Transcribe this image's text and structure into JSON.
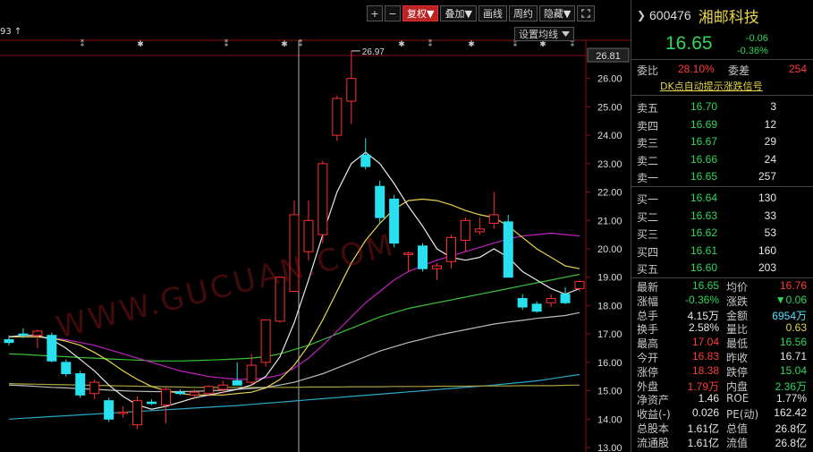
{
  "toolbar": {
    "zoom_in": "+",
    "zoom_out": "−",
    "fuquan": "复权▼",
    "diejia": "叠加▼",
    "huaxian": "画线",
    "zhouqi": "周约",
    "yincang": "隐藏▼"
  },
  "chart": {
    "top_label": "93 ↑",
    "ma_setting": "设置均线",
    "max_label": "26.97",
    "watermark": "WWW.GUCUAN.COM"
  },
  "chart_data": {
    "type": "candlestick",
    "ylim": [
      13.0,
      26.81
    ],
    "y_ticks": [
      13.0,
      14.0,
      15.0,
      16.0,
      17.0,
      18.0,
      19.0,
      20.0,
      21.0,
      22.0,
      23.0,
      24.0,
      25.0,
      26.0
    ],
    "top_value_label": "26.81",
    "candles": [
      {
        "o": 16.8,
        "h": 16.95,
        "l": 16.6,
        "c": 16.7
      },
      {
        "o": 17.0,
        "h": 17.2,
        "l": 16.85,
        "c": 16.95
      },
      {
        "o": 16.95,
        "h": 17.15,
        "l": 16.5,
        "c": 17.1
      },
      {
        "o": 16.95,
        "h": 17.05,
        "l": 16.0,
        "c": 16.05
      },
      {
        "o": 16.0,
        "h": 16.1,
        "l": 15.5,
        "c": 15.6
      },
      {
        "o": 15.6,
        "h": 15.7,
        "l": 14.75,
        "c": 14.85
      },
      {
        "o": 14.9,
        "h": 15.4,
        "l": 14.7,
        "c": 15.3
      },
      {
        "o": 14.65,
        "h": 14.75,
        "l": 13.9,
        "c": 14.0
      },
      {
        "o": 14.2,
        "h": 14.45,
        "l": 14.05,
        "c": 14.25
      },
      {
        "o": 13.8,
        "h": 14.8,
        "l": 13.65,
        "c": 14.65
      },
      {
        "o": 14.6,
        "h": 14.7,
        "l": 14.5,
        "c": 14.55
      },
      {
        "o": 14.5,
        "h": 15.1,
        "l": 13.85,
        "c": 15.05
      },
      {
        "o": 14.95,
        "h": 15.05,
        "l": 14.85,
        "c": 14.9
      },
      {
        "o": 14.85,
        "h": 15.05,
        "l": 14.7,
        "c": 14.95
      },
      {
        "o": 14.9,
        "h": 15.2,
        "l": 14.8,
        "c": 15.15
      },
      {
        "o": 15.05,
        "h": 15.35,
        "l": 14.9,
        "c": 15.2
      },
      {
        "o": 15.35,
        "h": 16.0,
        "l": 15.2,
        "c": 15.2
      },
      {
        "o": 15.3,
        "h": 16.3,
        "l": 15.2,
        "c": 15.9
      },
      {
        "o": 16.0,
        "h": 16.9,
        "l": 15.85,
        "c": 17.5
      },
      {
        "o": 17.45,
        "h": 19.0,
        "l": 17.4,
        "c": 19.0
      },
      {
        "o": 18.5,
        "h": 21.7,
        "l": 18.5,
        "c": 21.2
      },
      {
        "o": 19.9,
        "h": 21.7,
        "l": 19.6,
        "c": 21.0
      },
      {
        "o": 20.5,
        "h": 23.1,
        "l": 20.2,
        "c": 23.0
      },
      {
        "o": 24.0,
        "h": 25.4,
        "l": 23.8,
        "c": 25.3
      },
      {
        "o": 25.2,
        "h": 26.97,
        "l": 24.4,
        "c": 26.0
      },
      {
        "o": 23.3,
        "h": 23.9,
        "l": 22.8,
        "c": 22.9
      },
      {
        "o": 22.2,
        "h": 22.4,
        "l": 20.9,
        "c": 21.1
      },
      {
        "o": 21.75,
        "h": 21.9,
        "l": 20.05,
        "c": 20.2
      },
      {
        "o": 19.8,
        "h": 19.9,
        "l": 19.2,
        "c": 19.85
      },
      {
        "o": 20.1,
        "h": 20.2,
        "l": 19.2,
        "c": 19.3
      },
      {
        "o": 19.3,
        "h": 19.5,
        "l": 18.9,
        "c": 19.4
      },
      {
        "o": 19.55,
        "h": 20.5,
        "l": 19.3,
        "c": 20.4
      },
      {
        "o": 20.3,
        "h": 21.1,
        "l": 19.9,
        "c": 21.0
      },
      {
        "o": 20.6,
        "h": 21.1,
        "l": 20.5,
        "c": 20.7
      },
      {
        "o": 20.9,
        "h": 22.0,
        "l": 20.7,
        "c": 21.2
      },
      {
        "o": 20.95,
        "h": 21.2,
        "l": 19.0,
        "c": 19.0
      },
      {
        "o": 18.25,
        "h": 18.4,
        "l": 17.85,
        "c": 17.95
      },
      {
        "o": 18.05,
        "h": 18.15,
        "l": 17.75,
        "c": 17.8
      },
      {
        "o": 18.1,
        "h": 18.4,
        "l": 17.95,
        "c": 18.25
      },
      {
        "o": 18.4,
        "h": 18.65,
        "l": 18.05,
        "c": 18.1
      },
      {
        "o": 18.6,
        "h": 18.9,
        "l": 18.5,
        "c": 18.85
      }
    ],
    "ma_white": [
      16.9,
      16.95,
      16.95,
      16.8,
      16.5,
      16.1,
      15.7,
      15.2,
      14.8,
      14.5,
      14.35,
      14.45,
      14.6,
      14.75,
      14.85,
      14.95,
      15.05,
      15.2,
      15.5,
      16.2,
      17.4,
      18.9,
      20.5,
      22.0,
      23.0,
      23.4,
      23.0,
      22.3,
      21.5,
      20.8,
      20.0,
      19.7,
      19.6,
      19.7,
      20.0,
      19.7,
      19.2,
      18.9,
      18.6,
      18.4,
      18.6
    ],
    "ma_yellow": [
      16.9,
      16.9,
      16.9,
      16.85,
      16.75,
      16.6,
      16.35,
      16.05,
      15.7,
      15.4,
      15.15,
      15.0,
      14.9,
      14.85,
      14.85,
      14.85,
      14.9,
      14.95,
      15.1,
      15.4,
      15.9,
      16.6,
      17.5,
      18.5,
      19.5,
      20.3,
      20.9,
      21.4,
      21.7,
      21.75,
      21.7,
      21.55,
      21.35,
      21.2,
      21.1,
      20.8,
      20.4,
      20.0,
      19.7,
      19.4,
      19.3
    ],
    "ma_purple": [
      16.9,
      16.9,
      16.9,
      16.85,
      16.8,
      16.7,
      16.6,
      16.45,
      16.3,
      16.15,
      16.0,
      15.85,
      15.7,
      15.6,
      15.5,
      15.45,
      15.4,
      15.4,
      15.45,
      15.55,
      15.8,
      16.15,
      16.6,
      17.1,
      17.6,
      18.1,
      18.5,
      18.9,
      19.2,
      19.4,
      19.6,
      19.75,
      19.9,
      20.05,
      20.2,
      20.35,
      20.45,
      20.5,
      20.55,
      20.5,
      20.45
    ],
    "ma_green": [
      16.3,
      16.28,
      16.25,
      16.22,
      16.2,
      16.17,
      16.15,
      16.12,
      16.1,
      16.08,
      16.05,
      16.05,
      16.05,
      16.06,
      16.08,
      16.1,
      16.12,
      16.15,
      16.2,
      16.3,
      16.45,
      16.6,
      16.8,
      17.0,
      17.2,
      17.4,
      17.6,
      17.75,
      17.9,
      18.0,
      18.1,
      18.2,
      18.3,
      18.4,
      18.5,
      18.6,
      18.7,
      18.8,
      18.9,
      19.0,
      19.1
    ],
    "ma_gray": [
      15.2,
      15.18,
      15.15,
      15.12,
      15.1,
      15.07,
      15.05,
      15.02,
      15.0,
      14.98,
      14.97,
      14.97,
      14.97,
      14.98,
      15.0,
      15.02,
      15.05,
      15.08,
      15.12,
      15.2,
      15.3,
      15.45,
      15.6,
      15.8,
      16.0,
      16.2,
      16.4,
      16.55,
      16.7,
      16.82,
      16.95,
      17.05,
      17.15,
      17.25,
      17.35,
      17.42,
      17.48,
      17.55,
      17.6,
      17.65,
      17.75
    ],
    "ma_olive": [
      15.25,
      15.24,
      15.23,
      15.22,
      15.21,
      15.2,
      15.19,
      15.18,
      15.17,
      15.16,
      15.15,
      15.14,
      15.13,
      15.12,
      15.12,
      15.12,
      15.12,
      15.12,
      15.12,
      15.12,
      15.12,
      15.13,
      15.13,
      15.13,
      15.14,
      15.14,
      15.14,
      15.15,
      15.15,
      15.15,
      15.16,
      15.16,
      15.16,
      15.17,
      15.17,
      15.17,
      15.18,
      15.18,
      15.18,
      15.19,
      15.2
    ],
    "ma_cyan": [
      14.0,
      14.03,
      14.06,
      14.09,
      14.12,
      14.15,
      14.18,
      14.21,
      14.24,
      14.27,
      14.3,
      14.33,
      14.36,
      14.39,
      14.42,
      14.45,
      14.48,
      14.52,
      14.56,
      14.6,
      14.64,
      14.68,
      14.72,
      14.76,
      14.8,
      14.84,
      14.88,
      14.92,
      14.96,
      15.0,
      15.04,
      15.08,
      15.12,
      15.16,
      15.2,
      15.25,
      15.3,
      15.35,
      15.42,
      15.5,
      15.57
    ],
    "colors": {
      "up": "#ff3030",
      "down": "#28e0f0",
      "white": "#e8e8e8",
      "yellow": "#e6d54a",
      "purple": "#c020c0",
      "green": "#38c038",
      "gray": "#bdbdbd",
      "olive": "#a8a040",
      "cyan": "#2aa8c8"
    }
  },
  "panel": {
    "code": "600476",
    "name": "湘邮科技",
    "price": "16.65",
    "change": "-0.06",
    "change_pct": "-0.36%",
    "weibi_label": "委比",
    "weibi_value": "28.10%",
    "weicha_label": "委差",
    "weicha_value": "254",
    "signal_link": "DK点自动提示涨跌信号",
    "sell": [
      {
        "label": "卖五",
        "price": "16.70",
        "vol": "3"
      },
      {
        "label": "卖四",
        "price": "16.69",
        "vol": "12"
      },
      {
        "label": "卖三",
        "price": "16.67",
        "vol": "29"
      },
      {
        "label": "卖二",
        "price": "16.66",
        "vol": "24"
      },
      {
        "label": "卖一",
        "price": "16.65",
        "vol": "257"
      }
    ],
    "buy": [
      {
        "label": "买一",
        "price": "16.64",
        "vol": "130"
      },
      {
        "label": "买二",
        "price": "16.63",
        "vol": "33"
      },
      {
        "label": "买三",
        "price": "16.62",
        "vol": "53"
      },
      {
        "label": "买四",
        "price": "16.61",
        "vol": "160"
      },
      {
        "label": "买五",
        "price": "16.60",
        "vol": "203"
      }
    ],
    "stats": [
      {
        "l1": "最新",
        "v1": "16.65",
        "c1": "grn",
        "l2": "均价",
        "v2": "16.76",
        "c2": "red"
      },
      {
        "l1": "涨幅",
        "v1": "-0.36%",
        "c1": "grn",
        "l2": "涨跌",
        "v2": "▼0.06",
        "c2": "grn"
      },
      {
        "l1": "总手",
        "v1": "4.15万",
        "c1": "wht",
        "l2": "金额",
        "v2": "6954万",
        "c2": "cyan"
      },
      {
        "l1": "换手",
        "v1": "2.58%",
        "c1": "wht",
        "l2": "量比",
        "v2": "0.63",
        "c2": "yel"
      },
      {
        "l1": "最高",
        "v1": "17.04",
        "c1": "red",
        "l2": "最低",
        "v2": "16.56",
        "c2": "grn"
      },
      {
        "l1": "今开",
        "v1": "16.83",
        "c1": "red",
        "l2": "昨收",
        "v2": "16.71",
        "c2": "wht"
      },
      {
        "l1": "涨停",
        "v1": "18.38",
        "c1": "red",
        "l2": "跌停",
        "v2": "15.04",
        "c2": "grn"
      },
      {
        "l1": "外盘",
        "v1": "1.79万",
        "c1": "red",
        "l2": "内盘",
        "v2": "2.36万",
        "c2": "grn"
      },
      {
        "l1": "净资产",
        "v1": "1.46",
        "c1": "wht",
        "l2": "ROE",
        "v2": "1.77%",
        "c2": "wht"
      },
      {
        "l1": "收益(-)",
        "v1": "0.026",
        "c1": "wht",
        "l2": "PE(动)",
        "v2": "162.42",
        "c2": "wht"
      },
      {
        "l1": "总股本",
        "v1": "1.61亿",
        "c1": "wht",
        "l2": "总值",
        "v2": "26.8亿",
        "c2": "wht"
      },
      {
        "l1": "流通股",
        "v1": "1.61亿",
        "c1": "wht",
        "l2": "流值",
        "v2": "26.8亿",
        "c2": "wht"
      }
    ]
  }
}
